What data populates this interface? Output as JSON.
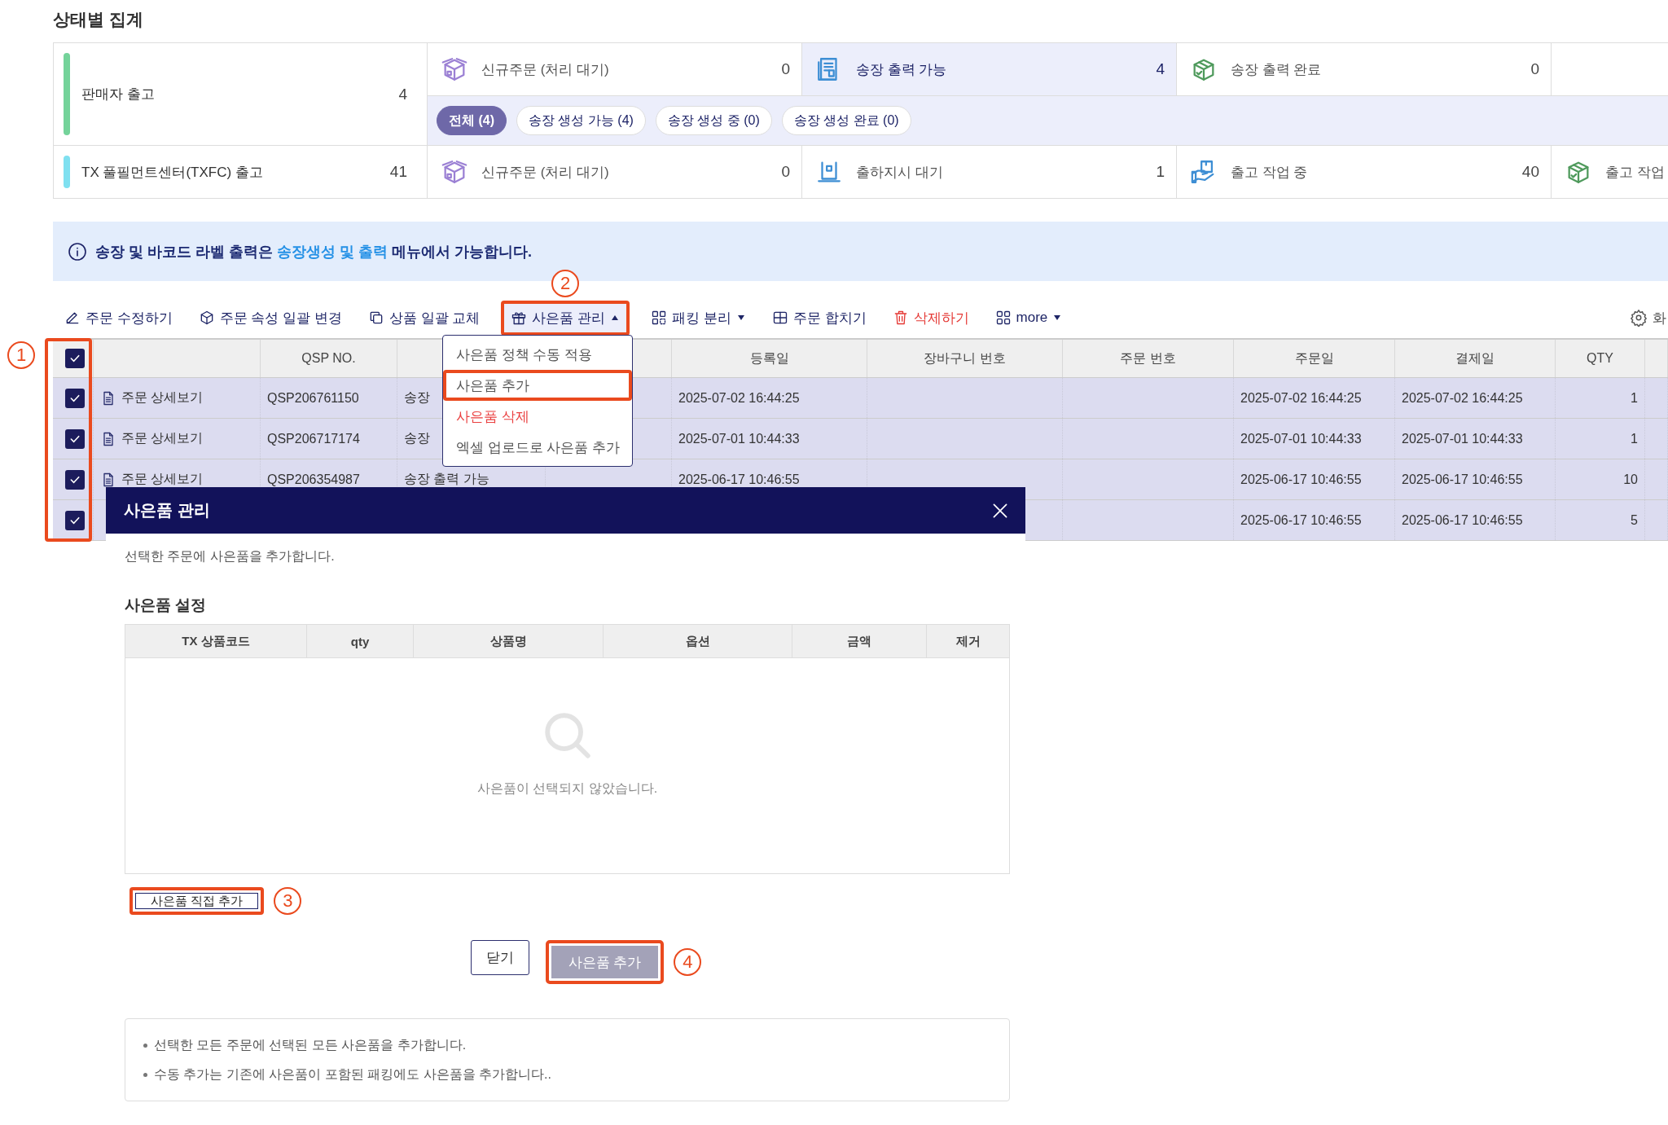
{
  "section_title": "상태별 집계",
  "summary": [
    {
      "label": "판매자 출고",
      "count": "4",
      "color": "#74d39a",
      "stages": [
        {
          "label": "신규주문 (처리 대기)",
          "count": "0",
          "selected": false
        },
        {
          "label": "송장 출력 가능",
          "count": "4",
          "selected": true
        },
        {
          "label": "송장 출력 완료",
          "count": "0",
          "selected": false
        }
      ],
      "filters": [
        {
          "label": "전체 (4)",
          "selected": true
        },
        {
          "label": "송장 생성 가능 (4)",
          "selected": false
        },
        {
          "label": "송장 생성 중 (0)",
          "selected": false
        },
        {
          "label": "송장 생성 완료 (0)",
          "selected": false
        }
      ]
    },
    {
      "label": "TX 풀필먼트센터(TXFC) 출고",
      "count": "41",
      "color": "#7fe0f0",
      "stages": [
        {
          "label": "신규주문 (처리 대기)",
          "count": "0",
          "selected": false
        },
        {
          "label": "출하지시 대기",
          "count": "1",
          "selected": false
        },
        {
          "label": "출고 작업 중",
          "count": "40",
          "selected": false
        },
        {
          "label": "출고 작업",
          "selected": false
        }
      ]
    }
  ],
  "info": {
    "before": "송장 및 바코드 라벨 출력은",
    "link": "송장생성 및 출력",
    "after": "메뉴에서 가능합니다."
  },
  "toolbar": [
    {
      "label": "주문 수정하기",
      "danger": false,
      "highlighted": false
    },
    {
      "label": "주문 속성 일괄 변경",
      "danger": false,
      "highlighted": false
    },
    {
      "label": "상품 일괄 교체",
      "danger": false,
      "highlighted": false
    },
    {
      "label": "사은품 관리",
      "danger": false,
      "expanded": true,
      "highlighted": true,
      "marker": "2"
    },
    {
      "label": "패킹 분리",
      "danger": false,
      "expanded": false,
      "highlighted": false
    },
    {
      "label": "주문 합치기",
      "danger": false,
      "highlighted": false
    },
    {
      "label": "삭제하기",
      "danger": true,
      "highlighted": false
    },
    {
      "label": "more",
      "danger": false,
      "expanded": false,
      "highlighted": false
    }
  ],
  "settings_label": "화",
  "table": {
    "select_all_checked": true,
    "checkbox_column_highlighted": true,
    "checkbox_marker": "1",
    "columns": [
      "QSP NO.",
      "등록일",
      "장바구니 번호",
      "주문 번호",
      "주문일",
      "결제일",
      "QTY"
    ],
    "rows": [
      {
        "checked": true,
        "detail": "주문 상세보기",
        "qsp_no": "QSP206761150",
        "status": "송장",
        "registered": "2025-07-02 16:44:25",
        "order_date": "2025-07-02 16:44:25",
        "paid_date": "2025-07-02 16:44:25",
        "qty": "1"
      },
      {
        "checked": true,
        "detail": "주문 상세보기",
        "qsp_no": "QSP206717174",
        "status": "송장",
        "registered": "2025-07-01 10:44:33",
        "order_date": "2025-07-01 10:44:33",
        "paid_date": "2025-07-01 10:44:33",
        "qty": "1"
      },
      {
        "checked": true,
        "detail": "주문 상세보기",
        "qsp_no": "QSP206354987",
        "status": "송장 출력 가능",
        "registered": "2025-06-17 10:46:55",
        "order_date": "2025-06-17 10:46:55",
        "paid_date": "2025-06-17 10:46:55",
        "qty": "10"
      },
      {
        "checked": true,
        "order_date": "2025-06-17 10:46:55",
        "paid_date": "2025-06-17 10:46:55",
        "qty": "5"
      }
    ]
  },
  "dropdown": [
    {
      "label": "사은품 정책 수동 적용",
      "danger": false,
      "highlighted": false
    },
    {
      "label": "사은품 추가",
      "danger": false,
      "highlighted": true
    },
    {
      "label": "사은품 삭제",
      "danger": true,
      "highlighted": false
    },
    {
      "label": "엑셀 업로드로 사은품 추가",
      "danger": false,
      "highlighted": false
    }
  ],
  "modal": {
    "title": "사은품 관리",
    "description": "선택한 주문에 사은품을 추가합니다.",
    "section_title": "사은품 설정",
    "columns": [
      "TX 상품코드",
      "qty",
      "상품명",
      "옵션",
      "금액",
      "제거"
    ],
    "empty_text": "사은품이 선택되지 않았습니다.",
    "direct_add": {
      "label": "사은품 직접 추가",
      "highlighted": true,
      "marker": "3"
    },
    "buttons": [
      {
        "label": "닫기",
        "kind": "secondary",
        "highlighted": false
      },
      {
        "label": "사은품 추가",
        "kind": "disabled",
        "highlighted": true,
        "marker": "4"
      }
    ],
    "notes": [
      "선택한 모든 주문에 선택된 모든 사은품을 추가합니다.",
      "수동 추가는 기존에 사은품이 포함된 패킹에도 사은품을 추가합니다.."
    ]
  }
}
